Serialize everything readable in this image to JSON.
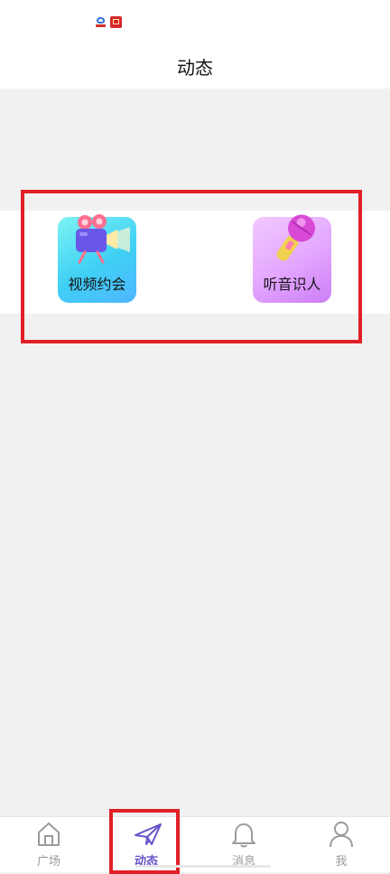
{
  "status_bar": {
    "icons": [
      "baidu-app-icon",
      "red-app-icon"
    ]
  },
  "header": {
    "title": "动态"
  },
  "features": [
    {
      "label": "视频约会",
      "icon": "video-camera-icon"
    },
    {
      "label": "听音识人",
      "icon": "microphone-icon"
    }
  ],
  "tabbar": {
    "active": "动态",
    "items": [
      {
        "label": "广场",
        "icon": "home-icon"
      },
      {
        "label": "动态",
        "icon": "paper-plane-icon"
      },
      {
        "label": "消息",
        "icon": "bell-icon"
      },
      {
        "label": "我",
        "icon": "person-icon"
      }
    ]
  },
  "colors": {
    "accent": "#6750c8",
    "highlight": "#e02026",
    "page_background": "#f1f1f1"
  }
}
